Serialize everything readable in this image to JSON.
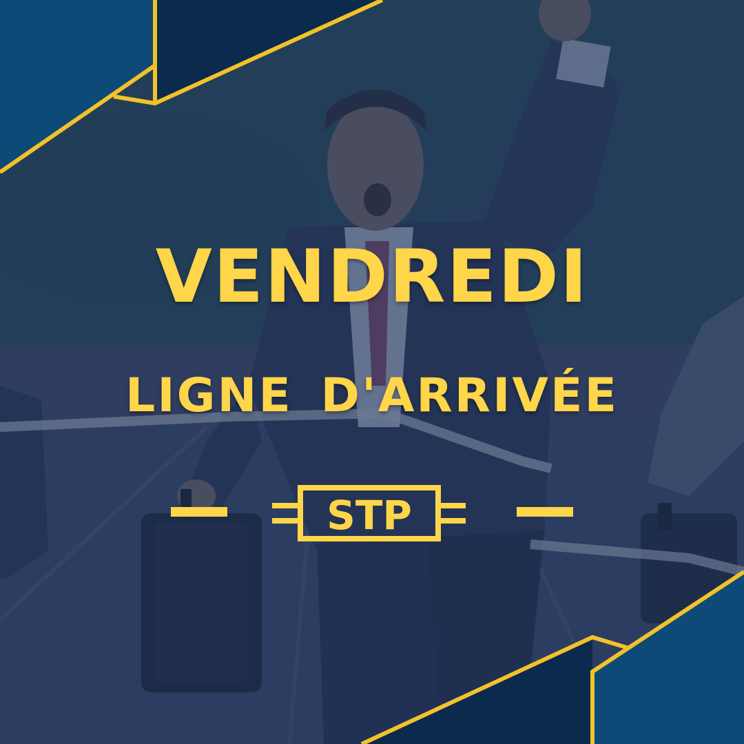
{
  "headline": "VENDREDI",
  "subheadline": "LIGNE D'ARRIVÉE",
  "logo": {
    "text": "STP",
    "icon": "stp-circuit-logo-icon"
  },
  "colors": {
    "accent": "#ffd54a",
    "overlay": "#1d3358",
    "triangle_dark": "#0c2a4d",
    "triangle_mid": "#0d4a78",
    "gold_line": "#f2c22b"
  }
}
